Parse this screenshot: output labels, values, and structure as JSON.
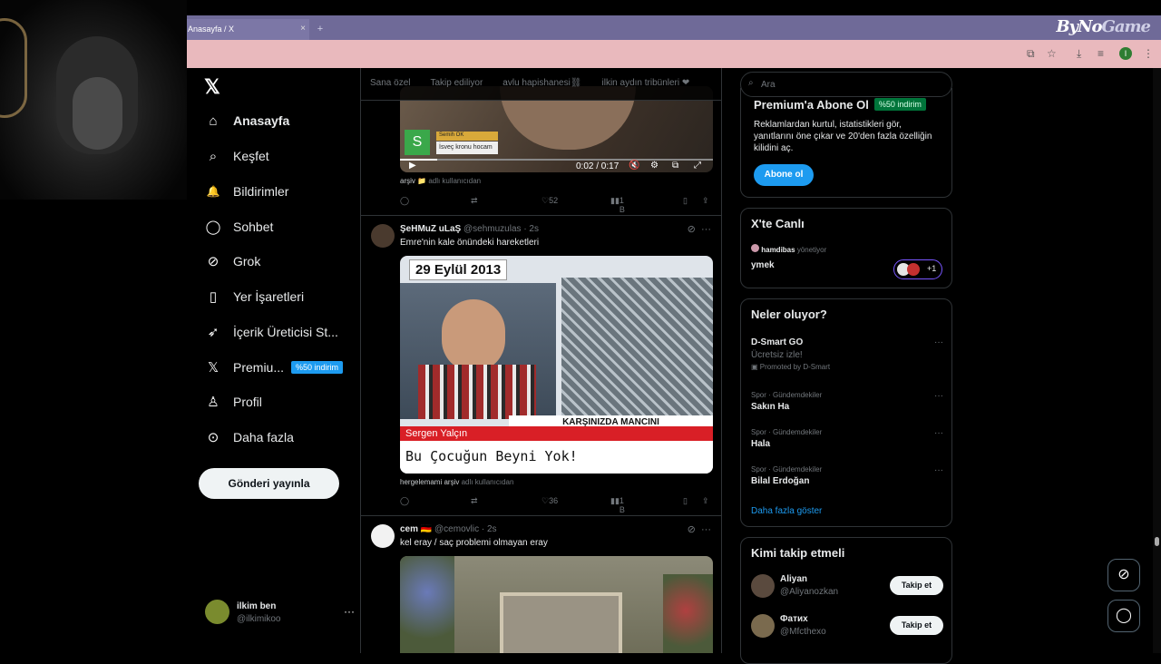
{
  "browser": {
    "tab_title": "Anasayfa / X",
    "tab_close": "×",
    "new_tab": "+",
    "brand": {
      "main": "ByNo",
      "accent": "Game"
    },
    "profile_letter": "I"
  },
  "sidebar": {
    "items": [
      {
        "label": "Anasayfa",
        "icon": "⌂"
      },
      {
        "label": "Keşfet",
        "icon": "⌕"
      },
      {
        "label": "Bildirimler",
        "icon": "🔔"
      },
      {
        "label": "Sohbet",
        "icon": "◯"
      },
      {
        "label": "Grok",
        "icon": "⊘"
      },
      {
        "label": "Yer İşaretleri",
        "icon": "▯"
      },
      {
        "label": "İçerik Üreticisi St...",
        "icon": "➶"
      },
      {
        "label": "Premiu...",
        "icon": "𝕏",
        "badge": "%50 indirim"
      },
      {
        "label": "Profil",
        "icon": "♙"
      },
      {
        "label": "Daha fazla",
        "icon": "⊙"
      }
    ],
    "post_button": "Gönderi yayınla",
    "account": {
      "name": "ilkim ben",
      "handle": "@ilkimikoo",
      "more": "···"
    }
  },
  "timeline": {
    "tabs": [
      "Sana özel",
      "Takip ediliyor",
      "avlu hapishanesi⛓",
      "ilkin aydın tribünleri ❤"
    ],
    "post1": {
      "video_time": "0:02 / 0:17",
      "overlay_name": "Semih OK",
      "overlay_text": "İsveç kronu hocam",
      "source_user": "arşiv 📁",
      "source_suffix": "adlı kullanıcıdan",
      "stats": {
        "likes": "52",
        "views": "1 B"
      }
    },
    "post2": {
      "name": "ŞeHMuZ uLaŞ",
      "handle": "@sehmuzulas",
      "time": "· 2s",
      "text": "Emre'nin kale önündeki hareketleri",
      "banner_date": "29 Eylül 2013",
      "lower_name": "Sergen Yalçın",
      "lower_text": "Bu Çocuğun Beyni Yok!",
      "ticker": "KARŞINIZDA MANCINI",
      "source_user": "hergelemami arşiv",
      "source_suffix": "adlı kullanıcıdan",
      "stats": {
        "likes": "36",
        "views": "1 B"
      }
    },
    "post3": {
      "name": "cem 🇩🇪",
      "handle": "@cemovlic",
      "time": "· 2s",
      "text": "kel eray / saç problemi olmayan eray"
    }
  },
  "right": {
    "search_placeholder": "Ara",
    "premium": {
      "title": "Premium'a Abone Ol",
      "badge": "%50 indirim",
      "desc": "Reklamlardan kurtul, istatistikleri gör, yanıtlarını öne çıkar ve 20'den fazla özelliğin kilidini aç.",
      "button": "Abone ol"
    },
    "live": {
      "title": "X'te Canlı",
      "host": "hamdibas",
      "host_suffix": "yönetiyor",
      "topic": "ymek",
      "extra": "+1"
    },
    "trends": {
      "title": "Neler oluyor?",
      "items": [
        {
          "cat": "",
          "name": "D-Smart GO",
          "sub": "Ücretsiz izle!",
          "promo": "Promoted by D-Smart"
        },
        {
          "cat": "Spor · Gündemdekiler",
          "name": "Sakın Ha"
        },
        {
          "cat": "Spor · Gündemdekiler",
          "name": "Hala"
        },
        {
          "cat": "Spor · Gündemdekiler",
          "name": "Bilal Erdoğan"
        }
      ],
      "more": "Daha fazla göster"
    },
    "who": {
      "title": "Kimi takip etmeli",
      "items": [
        {
          "name": "Aliyan",
          "handle": "@Aliyanozkan",
          "button": "Takip et"
        },
        {
          "name": "Фатих",
          "handle": "@Mfcthexo",
          "button": "Takip et"
        }
      ]
    }
  },
  "colors": {
    "accent": "#1d9bf0",
    "tabbar": "#6f6a98",
    "toolbar": "#e9b9bd"
  }
}
